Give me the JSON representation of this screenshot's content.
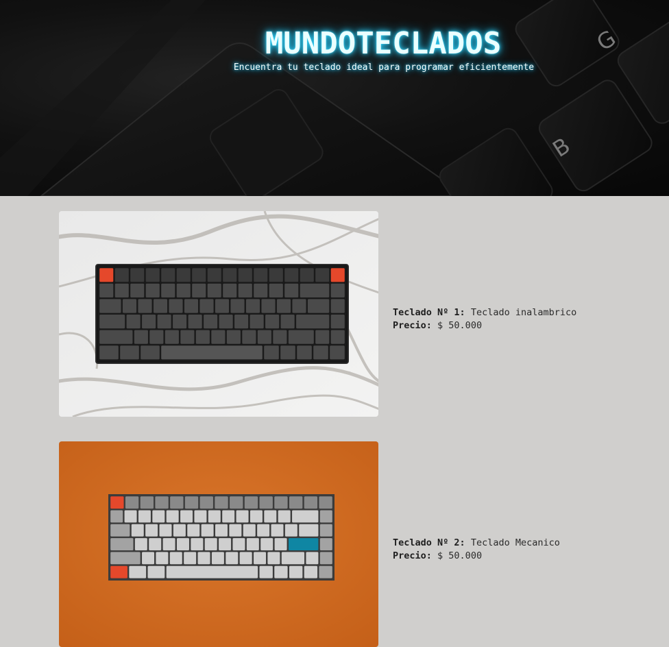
{
  "hero": {
    "title": "MUNDOTECLADOS",
    "subtitle": "Encuentra tu teclado ideal para programar eficientemente",
    "background_keys": [
      "G",
      "B"
    ],
    "accent_glow": "#33d7ff"
  },
  "products": [
    {
      "number_label": "Teclado Nº 1:",
      "name": "Teclado inalambrico",
      "price_label": "Precio:",
      "price": "$ 50.000",
      "image": "dark-keyboard-on-marble-photo"
    },
    {
      "number_label": "Teclado Nº 2:",
      "name": "Teclado Mecanico",
      "price_label": "Precio:",
      "price": "$ 50.000",
      "image": "gray-keyboard-on-orange-photo"
    }
  ],
  "colors": {
    "page_bg": "#d0cfcd",
    "accent_key": "#e5482b",
    "teal_key": "#0f86a3",
    "orange_bg": "#d06a1f"
  }
}
